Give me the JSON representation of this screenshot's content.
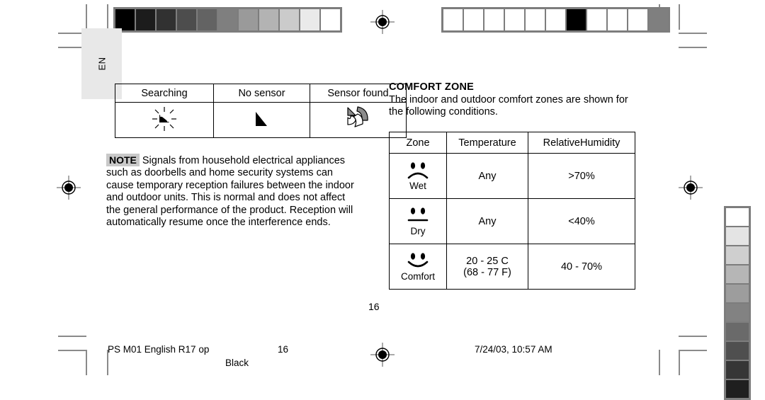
{
  "page": {
    "language_tab": "EN",
    "page_number_body": "16"
  },
  "sensor_table": {
    "headers": [
      "Searching",
      "No sensor",
      "Sensor found"
    ],
    "icons": [
      "searching-signal-icon",
      "no-sensor-icon",
      "sensor-found-icon"
    ]
  },
  "note": {
    "badge": "NOTE",
    "text": "Signals from household electrical appliances such as doorbells and home security systems can cause temporary reception failures between the indoor and outdoor units. This is normal and does not affect the general performance of the product. Reception will automatically resume once the interference ends."
  },
  "comfort": {
    "heading": "COMFORT ZONE",
    "intro": "The indoor and outdoor comfort zones are shown for the following conditions.",
    "headers": [
      "Zone",
      "Temperature",
      "RelativeHumidity"
    ],
    "rows": [
      {
        "zone": "Wet",
        "face": "sad-face-icon",
        "temperature": "Any",
        "temperature_line2": "",
        "humidity": ">70%"
      },
      {
        "zone": "Dry",
        "face": "neutral-face-icon",
        "temperature": "Any",
        "temperature_line2": "",
        "humidity": "<40%"
      },
      {
        "zone": "Comfort",
        "face": "happy-face-icon",
        "temperature": "20 - 25  C",
        "temperature_line2": "(68 - 77  F)",
        "humidity": "40 - 70%"
      }
    ]
  },
  "footer": {
    "file": "PS M01 English R17 op",
    "page": "16",
    "color_plate": "Black",
    "date": "7/24/03, 10:57 AM"
  },
  "print_marks": {
    "grayscale_top_left": [
      "#000000",
      "#1c1c1c",
      "#313131",
      "#4d4d4d",
      "#636363",
      "#7f7f7f",
      "#9a9a9a",
      "#b3b3b3",
      "#cbcbcb",
      "#eaeaea",
      "#ffffff"
    ],
    "grayscale_top_right": [
      "#ffffff",
      "#ffffff",
      "#ffffff",
      "#ffffff",
      "#ffffff",
      "#ffffff",
      "#000000",
      "#ffffff",
      "#ffffff",
      "#ffffff",
      "#7f7f7f"
    ],
    "grayscale_right_edge": [
      "#ffffff",
      "#e4e4e4",
      "#cfcfcf",
      "#b6b6b6",
      "#9d9d9d",
      "#828282",
      "#6a6a6a",
      "#4f4f4f",
      "#363636",
      "#1f1f1f"
    ],
    "registration_icon": "registration-target-icon"
  }
}
